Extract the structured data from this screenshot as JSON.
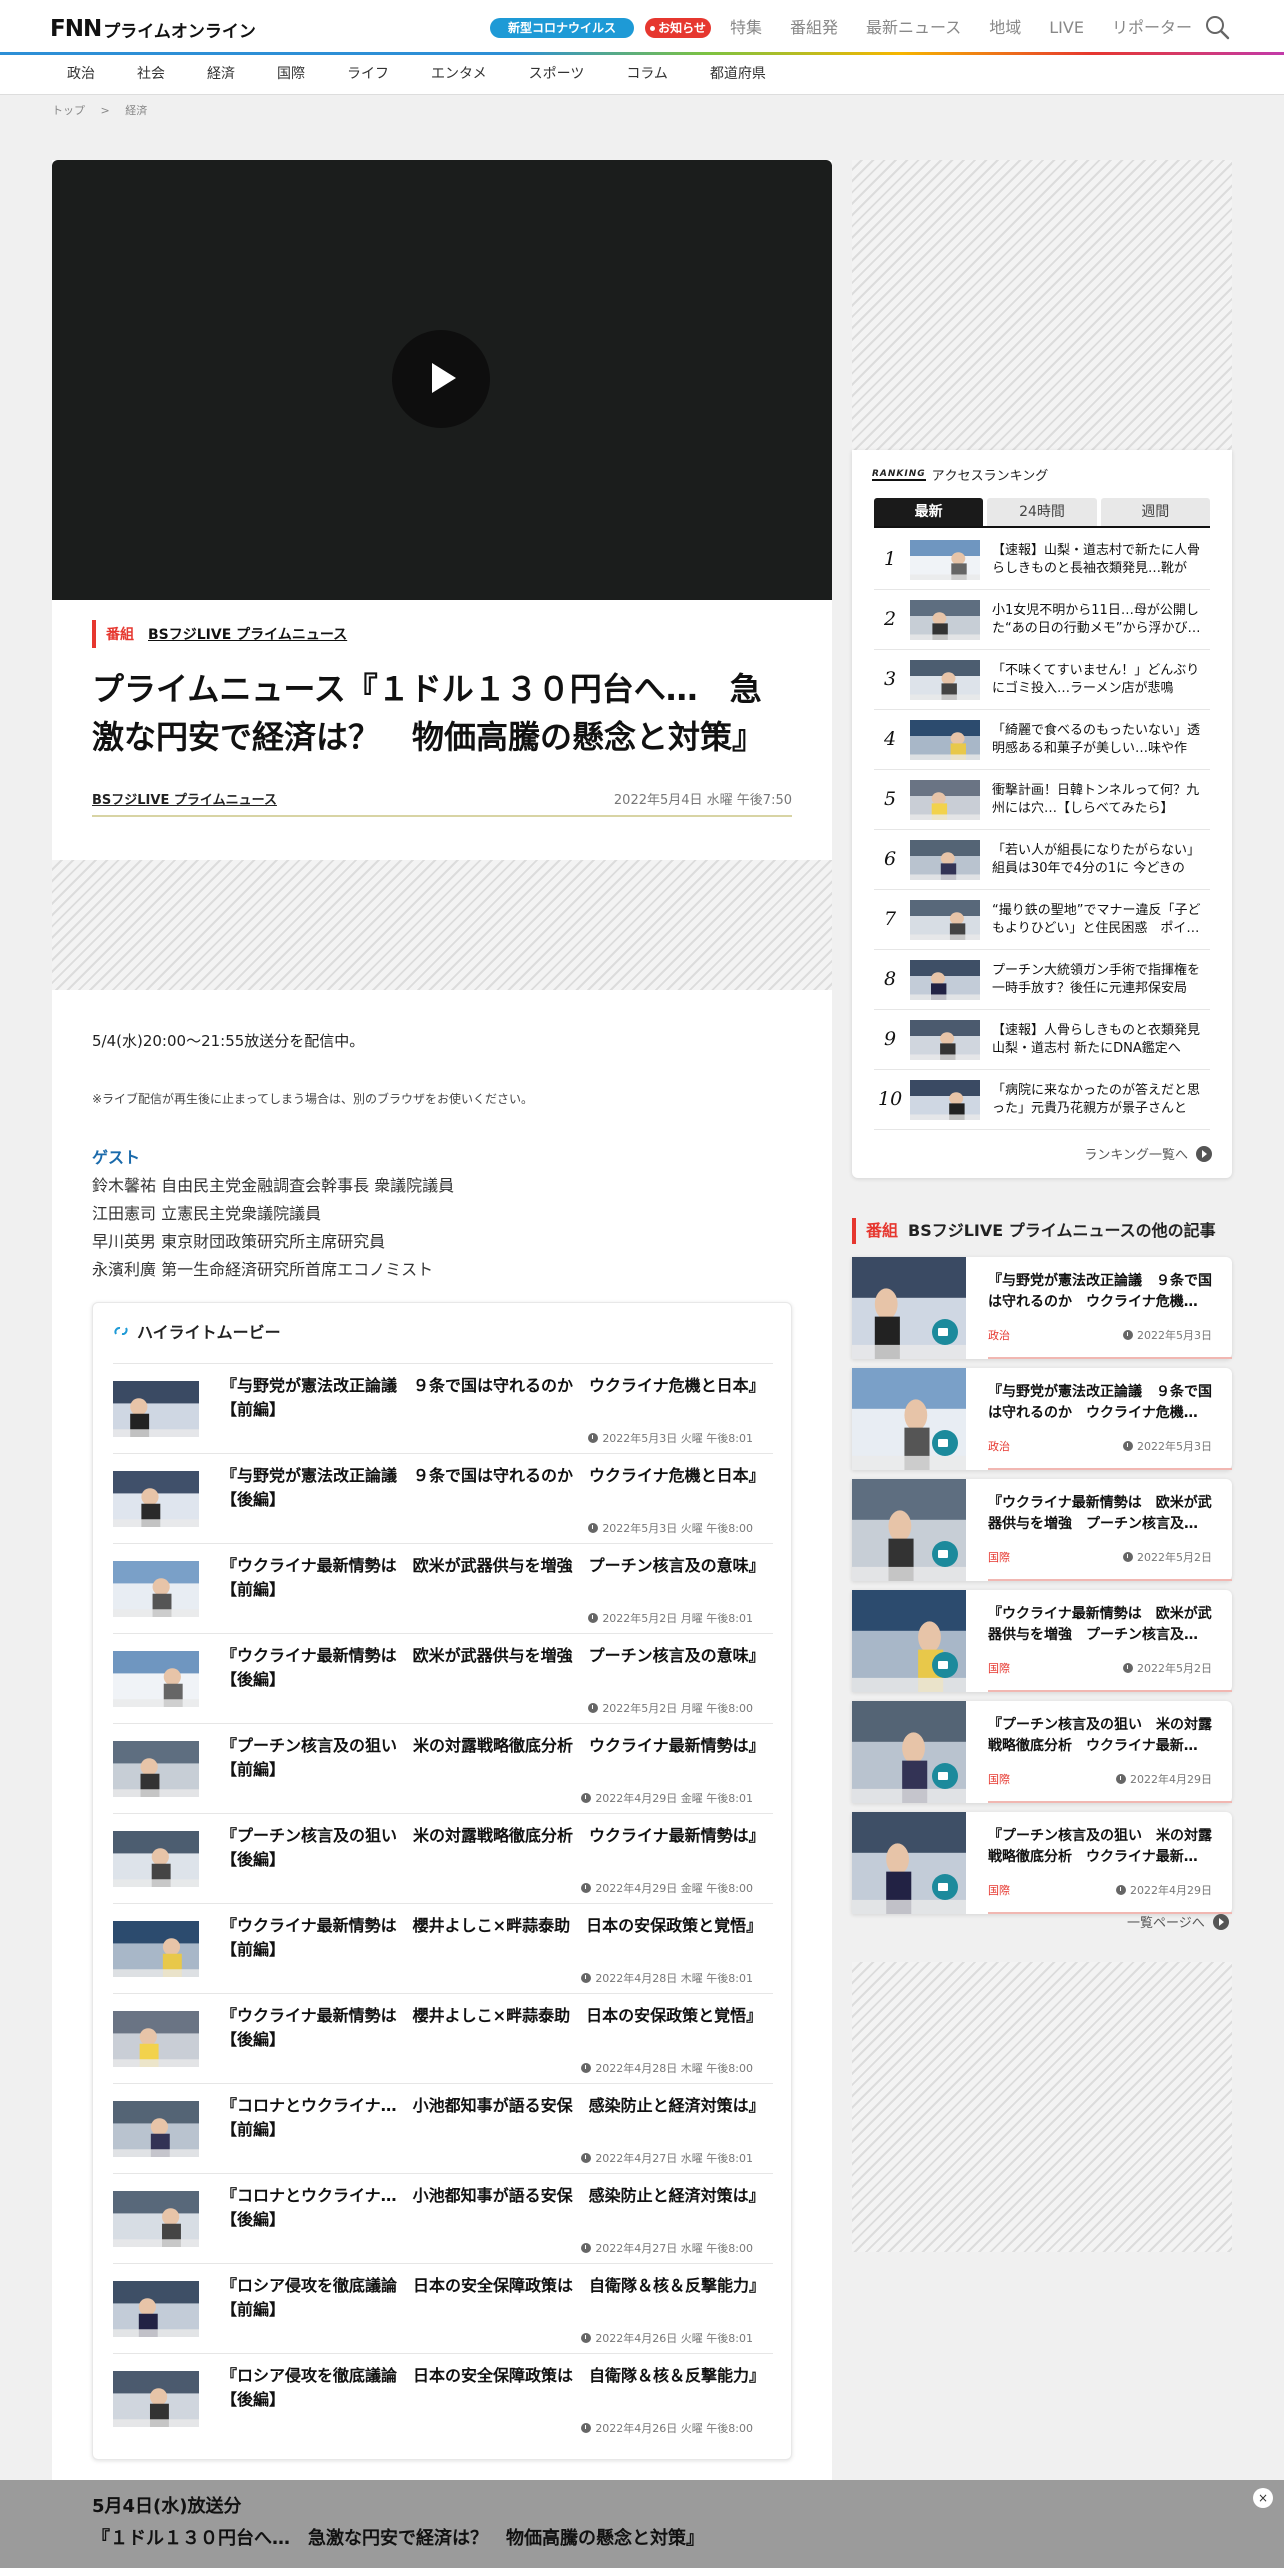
{
  "header": {
    "logo_main": "FNN",
    "logo_sub": "プライムオンライン",
    "covid_pill": "新型コロナウイルス",
    "notice_pill": "お知らせ",
    "nav": [
      "特集",
      "番組発",
      "最新ニュース",
      "地域",
      "LIVE",
      "リポーター"
    ]
  },
  "category_nav": [
    "政治",
    "社会",
    "経済",
    "国際",
    "ライフ",
    "エンタメ",
    "スポーツ",
    "コラム",
    "都道府県"
  ],
  "breadcrumb": {
    "home": "トップ",
    "sep": ">",
    "current": "経済"
  },
  "article": {
    "program_label": "番組",
    "program_name": "BSフジLIVE プライムニュース",
    "title": "プライムニュース『１ドル１３０円台へ…　急激な円安で経済は？　物価高騰の懸念と対策』",
    "byline": "BSフジLIVE プライムニュース",
    "date": "2022年5月4日 水曜 午後7:50",
    "body": "5/4(水)20:00～21:55放送分を配信中。",
    "note": "※ライブ配信が再生後に止まってしまう場合は、別のブラウザをお使いください。",
    "guest_heading": "ゲスト",
    "guests": [
      "鈴木馨祐 自由民主党金融調査会幹事長 衆議院議員",
      "江田憲司 立憲民主党衆議院議員",
      "早川英男 東京財団政策研究所主席研究員",
      "永濱利廣 第一生命経済研究所首席エコノミスト"
    ]
  },
  "highlights": {
    "heading": "ハイライトムービー",
    "items": [
      {
        "title": "『与野党が憲法改正論議　９条で国は守れるのか　ウクライナ危機と日本』【前編】",
        "date": "2022年5月3日 火曜 午後8:01"
      },
      {
        "title": "『与野党が憲法改正論議　９条で国は守れるのか　ウクライナ危機と日本』【後編】",
        "date": "2022年5月3日 火曜 午後8:00"
      },
      {
        "title": "『ウクライナ最新情勢は　欧米が武器供与を増強　プーチン核言及の意味』【前編】",
        "date": "2022年5月2日 月曜 午後8:01"
      },
      {
        "title": "『ウクライナ最新情勢は　欧米が武器供与を増強　プーチン核言及の意味』【後編】",
        "date": "2022年5月2日 月曜 午後8:00"
      },
      {
        "title": "『プーチン核言及の狙い　米の対露戦略徹底分析　ウクライナ最新情勢は』【前編】",
        "date": "2022年4月29日 金曜 午後8:01"
      },
      {
        "title": "『プーチン核言及の狙い　米の対露戦略徹底分析　ウクライナ最新情勢は』【後編】",
        "date": "2022年4月29日 金曜 午後8:00"
      },
      {
        "title": "『ウクライナ最新情勢は　櫻井よしこ×畔蒜泰助　日本の安保政策と覚悟』【前編】",
        "date": "2022年4月28日 木曜 午後8:01"
      },
      {
        "title": "『ウクライナ最新情勢は　櫻井よしこ×畔蒜泰助　日本の安保政策と覚悟』【後編】",
        "date": "2022年4月28日 木曜 午後8:00"
      },
      {
        "title": "『コロナとウクライナ…　小池都知事が語る安保　感染防止と経済対策は』【前編】",
        "date": "2022年4月27日 水曜 午後8:01"
      },
      {
        "title": "『コロナとウクライナ…　小池都知事が語る安保　感染防止と経済対策は』【後編】",
        "date": "2022年4月27日 水曜 午後8:00"
      },
      {
        "title": "『ロシア侵攻を徹底議論　日本の安全保障政策は　自衛隊＆核＆反撃能力』【前編】",
        "date": "2022年4月26日 火曜 午後8:01"
      },
      {
        "title": "『ロシア侵攻を徹底議論　日本の安全保障政策は　自衛隊＆核＆反撃能力』【後編】",
        "date": "2022年4月26日 火曜 午後8:00"
      }
    ]
  },
  "ranking": {
    "tag": "RANKING",
    "heading": "アクセスランキング",
    "tabs": [
      "最新",
      "24時間",
      "週間"
    ],
    "items": [
      "【速報】山梨・道志村で新たに人骨らしきものと長袖衣類発見…靴が見…",
      "小1女児不明から11日…母が公開した“あの日の行動メモ”から浮かび…",
      "「不味くてすいません！」どんぶりにゴミ投入…ラーメン店が悲鳴",
      "「綺麗で食べるのもったいない」透明感ある和菓子が美しい…味や作り…",
      "衝撃計画！日韓トンネルって何？九州には穴…【しらべてみたら】",
      "「若い人が組長になりたがらない」組員は30年で4分の1に 今どきの暴…",
      "“撮り鉄の聖地”でマナー違反「子どもよりひどい」と住民困惑　ポイ…",
      "プーチン大統領ガン手術で指揮権を一時手放す？後任に元連邦保安局長…",
      "【速報】人骨らしきものと衣類発見 山梨・道志村 新たにDNA鑑定へ",
      "「病院に来なかったのが答えだと思った」元貴乃花親方が景子さんと離…"
    ],
    "more": "ランキング一覧へ"
  },
  "others": {
    "label": "番組",
    "heading": "BSフジLIVE プライムニュースの他の記事",
    "items": [
      {
        "title": "『与野党が憲法改正論議　９条で国は守れるのか　ウクライナ危機…",
        "cat": "政治",
        "date": "2022年5月3日"
      },
      {
        "title": "『与野党が憲法改正論議　９条で国は守れるのか　ウクライナ危機…",
        "cat": "政治",
        "date": "2022年5月3日"
      },
      {
        "title": "『ウクライナ最新情勢は　欧米が武器供与を増強　プーチン核言及…",
        "cat": "国際",
        "date": "2022年5月2日"
      },
      {
        "title": "『ウクライナ最新情勢は　欧米が武器供与を増強　プーチン核言及…",
        "cat": "国際",
        "date": "2022年5月2日"
      },
      {
        "title": "『プーチン核言及の狙い　米の対露戦略徹底分析　ウクライナ最新…",
        "cat": "国際",
        "date": "2022年4月29日"
      },
      {
        "title": "『プーチン核言及の狙い　米の対露戦略徹底分析　ウクライナ最新…",
        "cat": "国際",
        "date": "2022年4月29日"
      }
    ],
    "more": "一覧ページへ"
  },
  "sticky": {
    "line1": "5月4日(水)放送分",
    "line2": "『１ドル１３０円台へ…　急激な円安で経済は？　物価高騰の懸念と対策』",
    "close": "×"
  }
}
